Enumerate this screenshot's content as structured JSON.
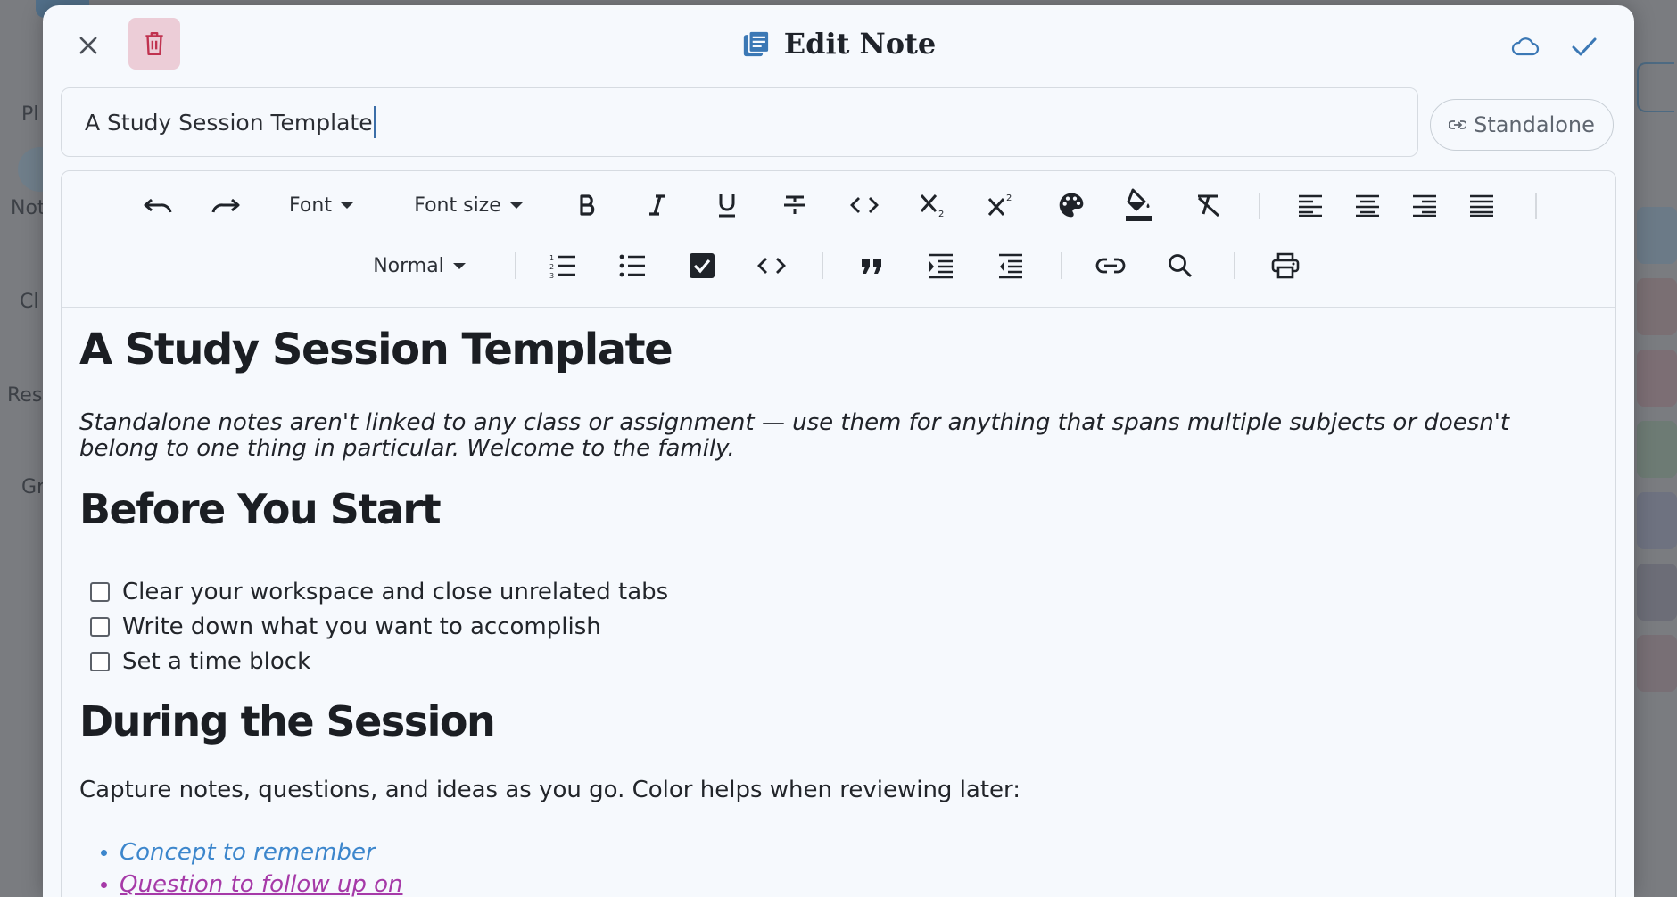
{
  "background": {
    "sidebar_fragments": [
      "Pl",
      "Not",
      "Cl",
      "Res",
      "Gr"
    ],
    "bars": [
      "#6b7a87",
      "#7a6f73",
      "#7c6e74",
      "#6d7b74",
      "#6e7280",
      "#6c6d77",
      "#786f75"
    ]
  },
  "modal": {
    "title": "Edit Note",
    "title_field_value": "A Study Session Template",
    "assoc_button_label": "Standalone",
    "colors": {
      "accent": "#3b78b5",
      "delete_bg": "#eccdd7",
      "delete_icon": "#c0324f",
      "surface": "#f6f9fd"
    }
  },
  "toolbar": {
    "font_label": "Font",
    "font_size_label": "Font size",
    "block_label": "Normal",
    "icons": [
      "undo-icon",
      "redo-icon",
      "bold-icon",
      "italic-icon",
      "underline-icon",
      "strikethrough-icon",
      "code-icon",
      "subscript-icon",
      "superscript-icon",
      "palette-icon",
      "fill-color-icon",
      "clear-format-icon",
      "align-left-icon",
      "align-center-icon",
      "align-right-icon",
      "align-justify-icon",
      "ordered-list-icon",
      "bullet-list-icon",
      "checklist-icon",
      "code-block-icon",
      "blockquote-icon",
      "indent-icon",
      "outdent-icon",
      "link-icon",
      "search-icon",
      "print-icon"
    ]
  },
  "doc": {
    "h1": "A Study Session Template",
    "intro_line1": "Standalone notes aren't linked to any class or assignment — use them for anything that spans multiple subjects or doesn't",
    "intro_line2": "belong to one thing in particular. Welcome to the family.",
    "h2a": "Before You Start",
    "checklist": [
      "Clear your workspace and close unrelated tabs",
      "Write down what you want to accomplish",
      "Set a time block"
    ],
    "h2b": "During the Session",
    "paragraph": "Capture notes, questions, and ideas as you go. Color helps when reviewing later:",
    "bullets": [
      {
        "text": "Concept to remember",
        "color": "#3c86cc"
      },
      {
        "text": "Question to follow up on",
        "color": "#a63aa8"
      }
    ]
  }
}
